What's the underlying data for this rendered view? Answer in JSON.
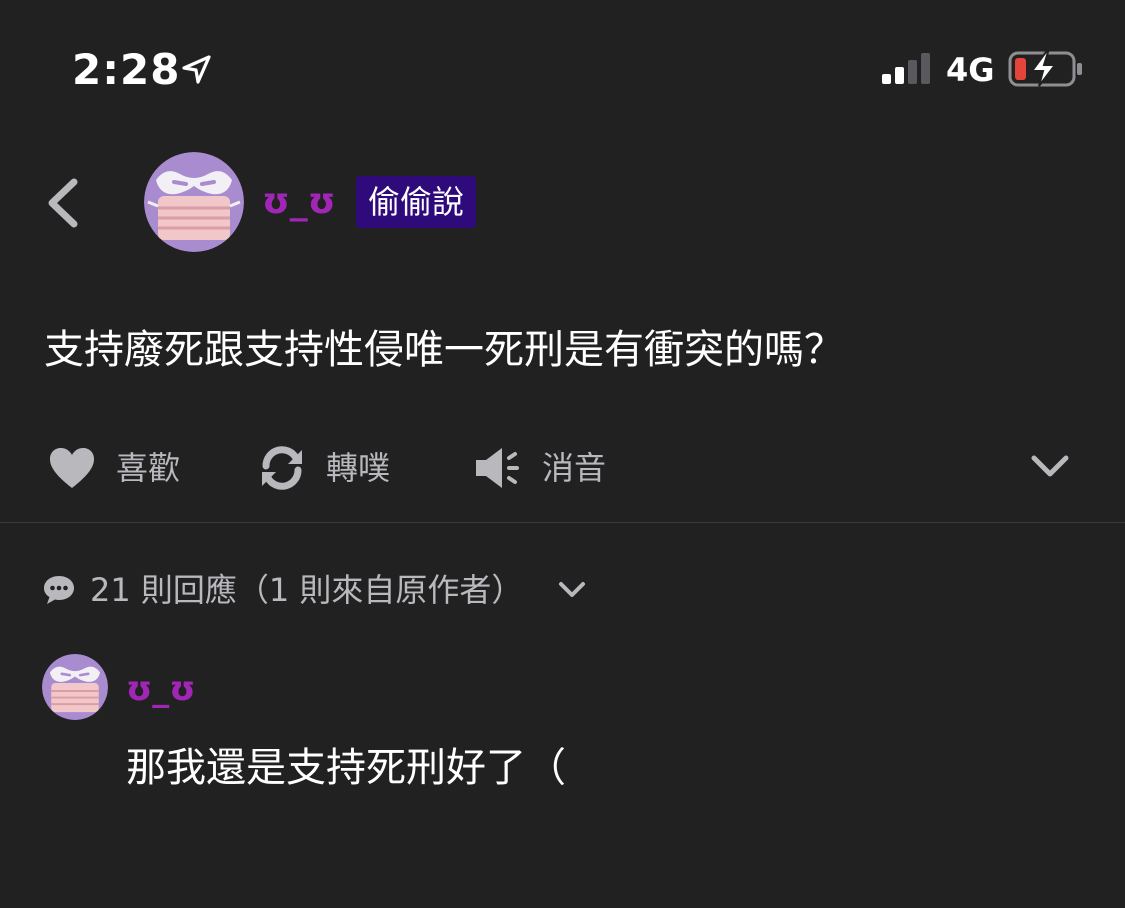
{
  "status_bar": {
    "time": "2:28",
    "network": "4G",
    "icons": [
      "location-arrow-icon",
      "signal-icon",
      "battery-charging-icon"
    ]
  },
  "header": {
    "author": "ʊ_ʊ",
    "badge": "偷偷說"
  },
  "post": {
    "content": "支持廢死跟支持性侵唯一死刑是有衝突的嗎？"
  },
  "actions": {
    "like": "喜歡",
    "replurk": "轉噗",
    "mute": "消音"
  },
  "responses": {
    "summary": "21 則回應（1 則來自原作者）"
  },
  "reply": {
    "author": "ʊ_ʊ",
    "content": "那我還是支持死刑好了（"
  },
  "colors": {
    "background": "#212122",
    "author_name": "#a126b6",
    "badge_bg": "#2f0a7a",
    "icon_gray": "#b8b8bd",
    "avatar_bg": "#a98bd0",
    "battery_low": "#e5443a"
  }
}
